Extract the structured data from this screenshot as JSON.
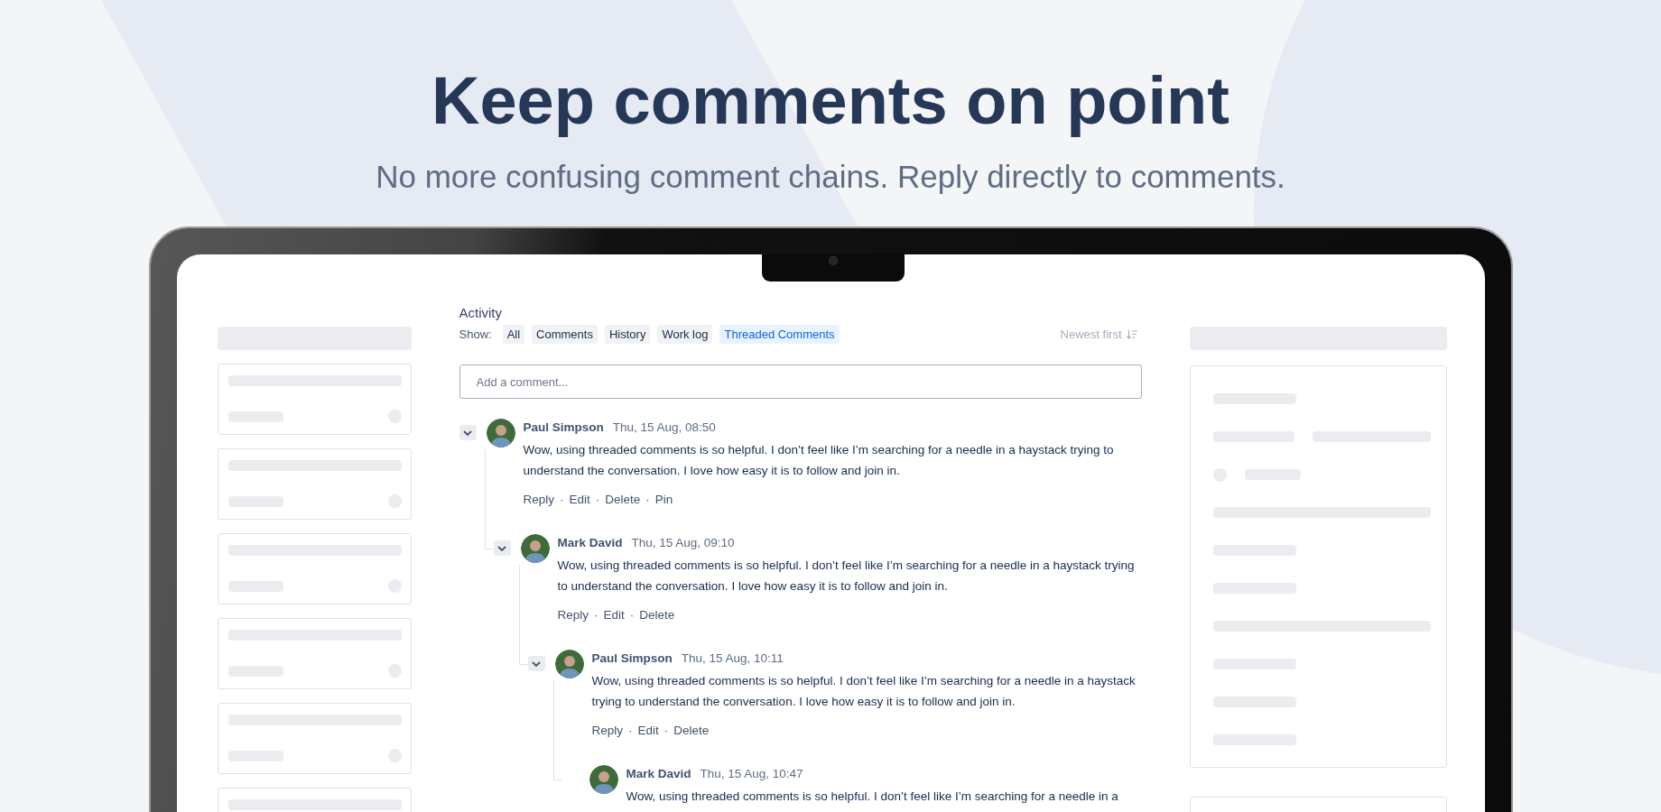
{
  "headline": {
    "title": "Keep comments on point",
    "subtitle": "No more confusing comment chains. Reply directly to comments."
  },
  "activity": {
    "title": "Activity",
    "show_label": "Show:",
    "filters": [
      {
        "label": "All",
        "selected": false
      },
      {
        "label": "Comments",
        "selected": false
      },
      {
        "label": "History",
        "selected": false
      },
      {
        "label": "Work log",
        "selected": false
      },
      {
        "label": "Threaded Comments",
        "selected": true
      }
    ],
    "sort": {
      "label": "Newest first"
    },
    "comment_field": {
      "placeholder": "Add a comment..."
    },
    "action_separator": "·",
    "comments": [
      {
        "author": "Paul Simpson",
        "time": "Thu, 15 Aug, 08:50",
        "text": "Wow, using threaded comments is so helpful. I don’t feel like I’m searching for a needle in a haystack trying to understand the conversation. I love how easy it is to follow and join in.",
        "actions": [
          "Reply",
          "Edit",
          "Delete",
          "Pin"
        ],
        "expanded": true,
        "children": [
          {
            "author": "Mark David",
            "time": "Thu, 15 Aug, 09:10",
            "text": "Wow, using threaded comments is so helpful. I don’t feel like I’m searching for a needle in a haystack trying to understand the conversation. I love how easy it is to follow and join in.",
            "actions": [
              "Reply",
              "Edit",
              "Delete"
            ],
            "expanded": true,
            "children": [
              {
                "author": "Paul Simpson",
                "time": "Thu, 15 Aug, 10:11",
                "text": "Wow, using threaded comments is so helpful. I don’t feel like I’m searching for a needle in a haystack trying to understand the conversation. I love how easy it is to follow and join in.",
                "actions": [
                  "Reply",
                  "Edit",
                  "Delete"
                ],
                "expanded": true,
                "children": [
                  {
                    "author": "Mark David",
                    "time": "Thu, 15 Aug, 10:47",
                    "text": "Wow, using threaded comments is so helpful. I don’t feel like I’m searching for a needle in a"
                  }
                ]
              }
            ]
          }
        ]
      }
    ]
  }
}
